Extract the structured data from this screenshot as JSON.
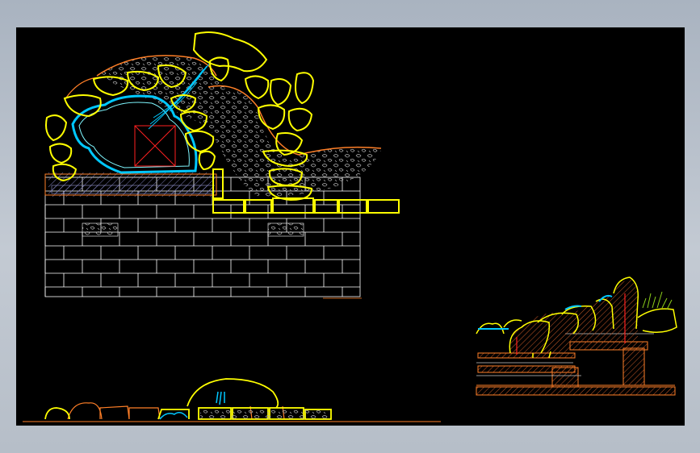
{
  "viewport": {
    "title": "",
    "background_color": "#000000",
    "frame_color": "#b6bec8"
  },
  "drawing": {
    "colors": {
      "rock_outline": "#ffff00",
      "water": "#00c8ff",
      "water_light": "#7ff7ff",
      "soil": "#ff7f27",
      "brick": "#ffffff",
      "hatch": "#9a9ad6",
      "gravel": "#a8a8a8",
      "marker": "#ff2020",
      "plant": "#8ccf1a",
      "section_fill": "#c85a28"
    },
    "views": [
      {
        "id": "rockery-elevation",
        "kind": "front-elevation"
      },
      {
        "id": "rockery-plan",
        "kind": "plan"
      },
      {
        "id": "rockery-section",
        "kind": "section"
      }
    ]
  }
}
